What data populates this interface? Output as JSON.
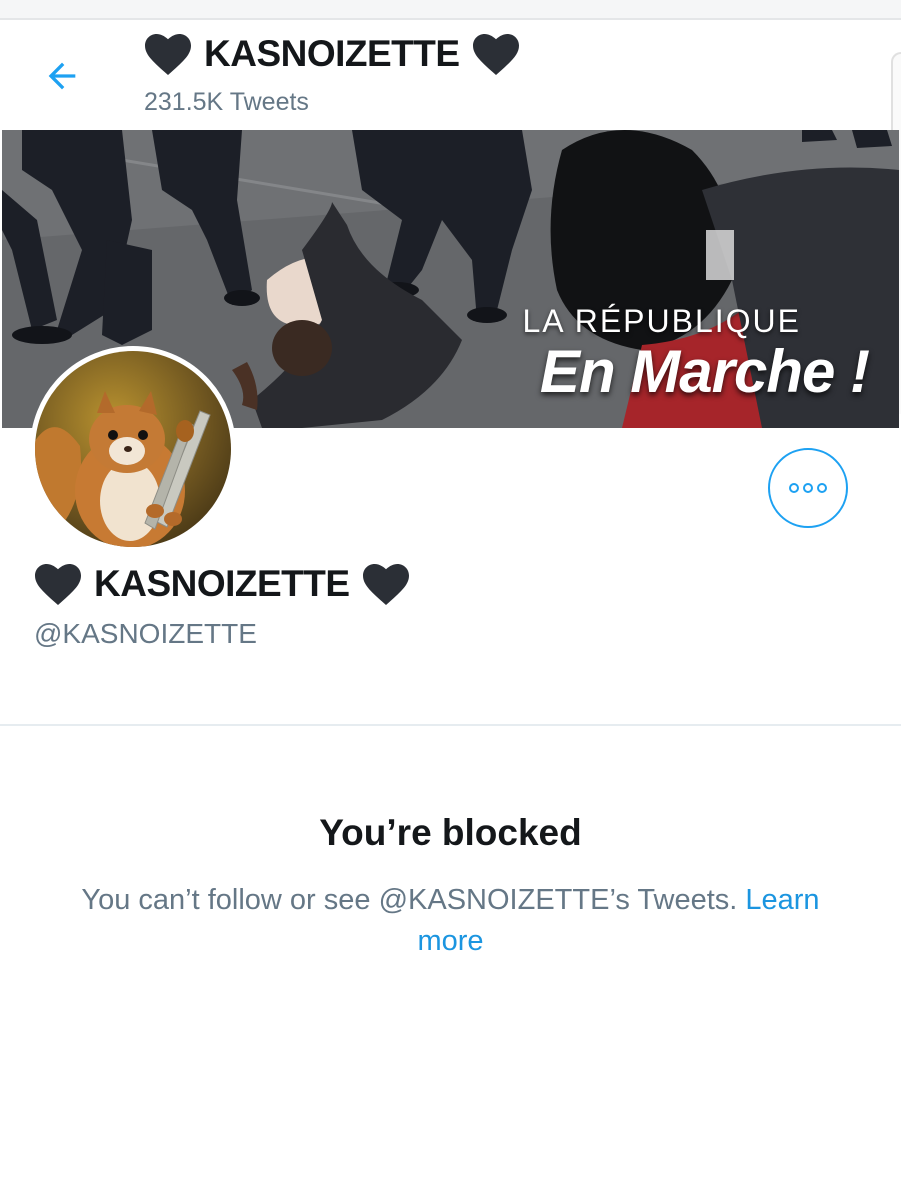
{
  "header": {
    "heart_left_icon": "heart-icon",
    "title": "KASNOIZETTE",
    "heart_right_icon": "heart-icon",
    "tweet_count": "231.5K Tweets",
    "back_icon": "arrow-left-icon"
  },
  "banner": {
    "line1": "LA RÉPUBLIQUE",
    "line2": "En Marche !"
  },
  "profile": {
    "display_name": "KASNOIZETTE",
    "handle": "@KASNOIZETTE",
    "more_icon": "more-horizontal-icon"
  },
  "blocked": {
    "title": "You’re blocked",
    "message": "You can’t follow or see @KASNOIZETTE’s Tweets.",
    "link": "Learn more"
  },
  "colors": {
    "accent": "#1da1f2",
    "link": "#1b95e0",
    "text_primary": "#14171a",
    "text_secondary": "#657786",
    "heart": "#2b2f36"
  }
}
